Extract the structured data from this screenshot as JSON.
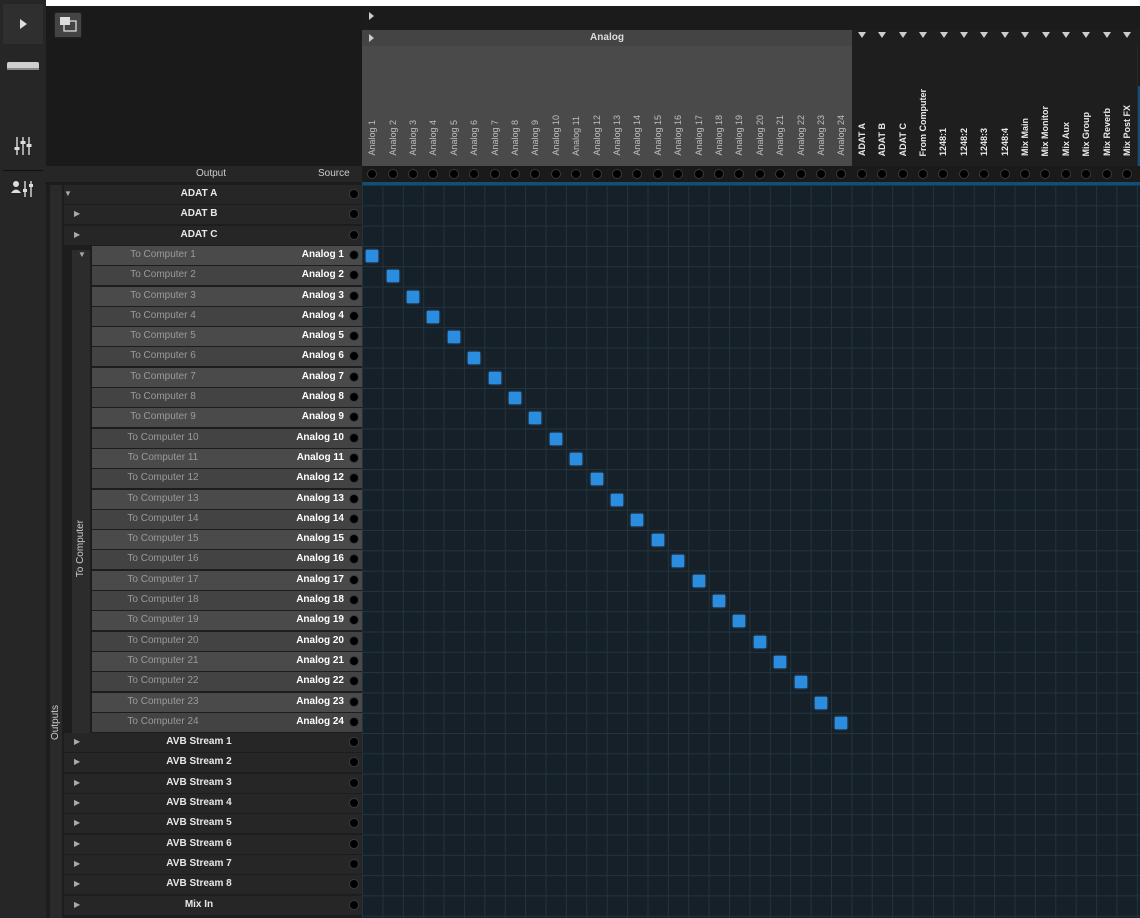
{
  "header": {
    "analog_group": "Analog"
  },
  "columns": {
    "analog": [
      "Analog 1",
      "Analog 2",
      "Analog 3",
      "Analog 4",
      "Analog 5",
      "Analog 6",
      "Analog 7",
      "Analog 8",
      "Analog 9",
      "Analog 10",
      "Analog 11",
      "Analog 12",
      "Analog 13",
      "Analog 14",
      "Analog 15",
      "Analog 16",
      "Analog 17",
      "Analog 18",
      "Analog 19",
      "Analog 20",
      "Analog 21",
      "Analog 22",
      "Analog 23",
      "Analog 24"
    ],
    "other": [
      "ADAT A",
      "ADAT B",
      "ADAT C",
      "From Computer",
      "1248:1",
      "1248:2",
      "1248:3",
      "1248:4",
      "Mix Main",
      "Mix Monitor",
      "Mix Aux",
      "Mix Group",
      "Mix Reverb",
      "Mix Post FX"
    ]
  },
  "table_header": {
    "output": "Output",
    "source": "Source"
  },
  "side_labels": {
    "outputs": "Outputs",
    "to_computer": "To Computer"
  },
  "groups_top": [
    "ADAT A",
    "ADAT B",
    "ADAT C"
  ],
  "to_computer_rows": [
    {
      "output": "To Computer 1",
      "source": "Analog 1"
    },
    {
      "output": "To Computer 2",
      "source": "Analog 2"
    },
    {
      "output": "To Computer 3",
      "source": "Analog 3"
    },
    {
      "output": "To Computer 4",
      "source": "Analog 4"
    },
    {
      "output": "To Computer 5",
      "source": "Analog 5"
    },
    {
      "output": "To Computer 6",
      "source": "Analog 6"
    },
    {
      "output": "To Computer 7",
      "source": "Analog 7"
    },
    {
      "output": "To Computer 8",
      "source": "Analog 8"
    },
    {
      "output": "To Computer 9",
      "source": "Analog 9"
    },
    {
      "output": "To Computer 10",
      "source": "Analog 10"
    },
    {
      "output": "To Computer 11",
      "source": "Analog 11"
    },
    {
      "output": "To Computer 12",
      "source": "Analog 12"
    },
    {
      "output": "To Computer 13",
      "source": "Analog 13"
    },
    {
      "output": "To Computer 14",
      "source": "Analog 14"
    },
    {
      "output": "To Computer 15",
      "source": "Analog 15"
    },
    {
      "output": "To Computer 16",
      "source": "Analog 16"
    },
    {
      "output": "To Computer 17",
      "source": "Analog 17"
    },
    {
      "output": "To Computer 18",
      "source": "Analog 18"
    },
    {
      "output": "To Computer 19",
      "source": "Analog 19"
    },
    {
      "output": "To Computer 20",
      "source": "Analog 20"
    },
    {
      "output": "To Computer 21",
      "source": "Analog 21"
    },
    {
      "output": "To Computer 22",
      "source": "Analog 22"
    },
    {
      "output": "To Computer 23",
      "source": "Analog 23"
    },
    {
      "output": "To Computer 24",
      "source": "Analog 24"
    }
  ],
  "groups_bottom": [
    "AVB Stream 1",
    "AVB Stream 2",
    "AVB Stream 3",
    "AVB Stream 4",
    "AVB Stream 5",
    "AVB Stream 6",
    "AVB Stream 7",
    "AVB Stream 8",
    "Mix In"
  ],
  "colors": {
    "accent": "#2a8de0",
    "selected_tool": "#0f4f7c",
    "grid_bg": "#162028"
  }
}
